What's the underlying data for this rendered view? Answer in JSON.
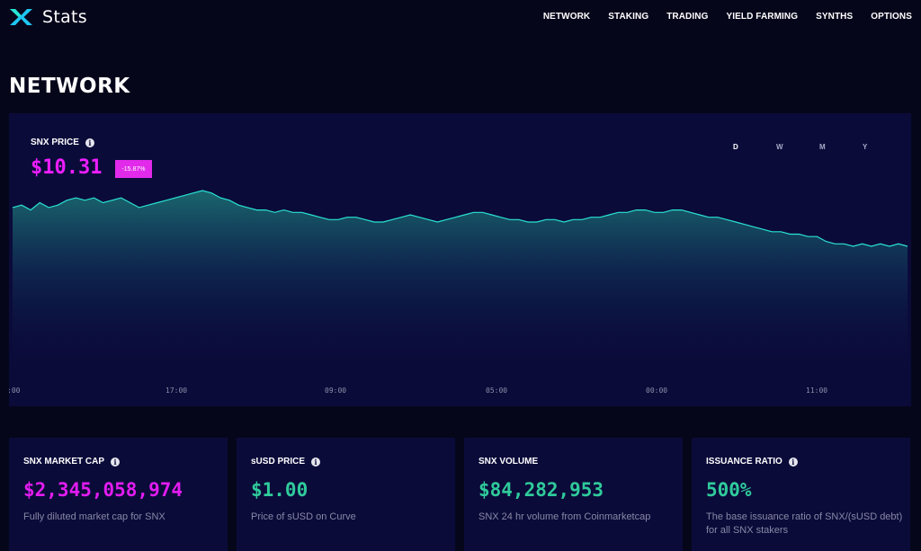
{
  "header": {
    "logo_text": "Stats",
    "nav": [
      "NETWORK",
      "STAKING",
      "TRADING",
      "YIELD FARMING",
      "SYNTHS",
      "OPTIONS"
    ]
  },
  "page_title": "NETWORK",
  "price_chart": {
    "label": "SNX PRICE",
    "price": "$10.31",
    "change": "-15.87%",
    "periods": [
      "D",
      "W",
      "M",
      "Y"
    ],
    "active_period": "D",
    "x_ticks": [
      ":00",
      "17:00",
      "09:00",
      "05:00",
      "00:00",
      "11:00"
    ],
    "line_color": "#29e3d2",
    "series": [
      100,
      101,
      99,
      102,
      100,
      101,
      103,
      104,
      103,
      104,
      102,
      103,
      104,
      102,
      100,
      101,
      102,
      103,
      104,
      105,
      106,
      107,
      106,
      104,
      103,
      101,
      100,
      99,
      99,
      98,
      99,
      98,
      98,
      97,
      96,
      95,
      95,
      96,
      96,
      95,
      94,
      94,
      95,
      96,
      97,
      96,
      95,
      94,
      95,
      96,
      97,
      98,
      98,
      97,
      96,
      95,
      95,
      94,
      94,
      95,
      95,
      94,
      95,
      95,
      96,
      96,
      97,
      98,
      98,
      99,
      99,
      98,
      98,
      99,
      99,
      98,
      97,
      96,
      96,
      95,
      94,
      93,
      92,
      91,
      90,
      90,
      89,
      89,
      88,
      88,
      86,
      85,
      85,
      84,
      85,
      84,
      85,
      84,
      85,
      84
    ]
  },
  "cards": [
    {
      "title": "SNX MARKET CAP",
      "value": "$2,345,058,974",
      "description": "Fully diluted market cap for SNX",
      "color": "#e21cf0",
      "info": true
    },
    {
      "title": "sUSD PRICE",
      "value": "$1.00",
      "description": "Price of sUSD on Curve",
      "color": "#2fcb9b",
      "info": true
    },
    {
      "title": "SNX VOLUME",
      "value": "$84,282,953",
      "description": "SNX 24 hr volume from Coinmarketcap",
      "color": "#2fcb9b",
      "info": false
    },
    {
      "title": "ISSUANCE RATIO",
      "value": "500%",
      "description": "The base issuance ratio of SNX/(sUSD debt) for all SNX stakers",
      "color": "#2fcb9b",
      "info": true
    }
  ]
}
